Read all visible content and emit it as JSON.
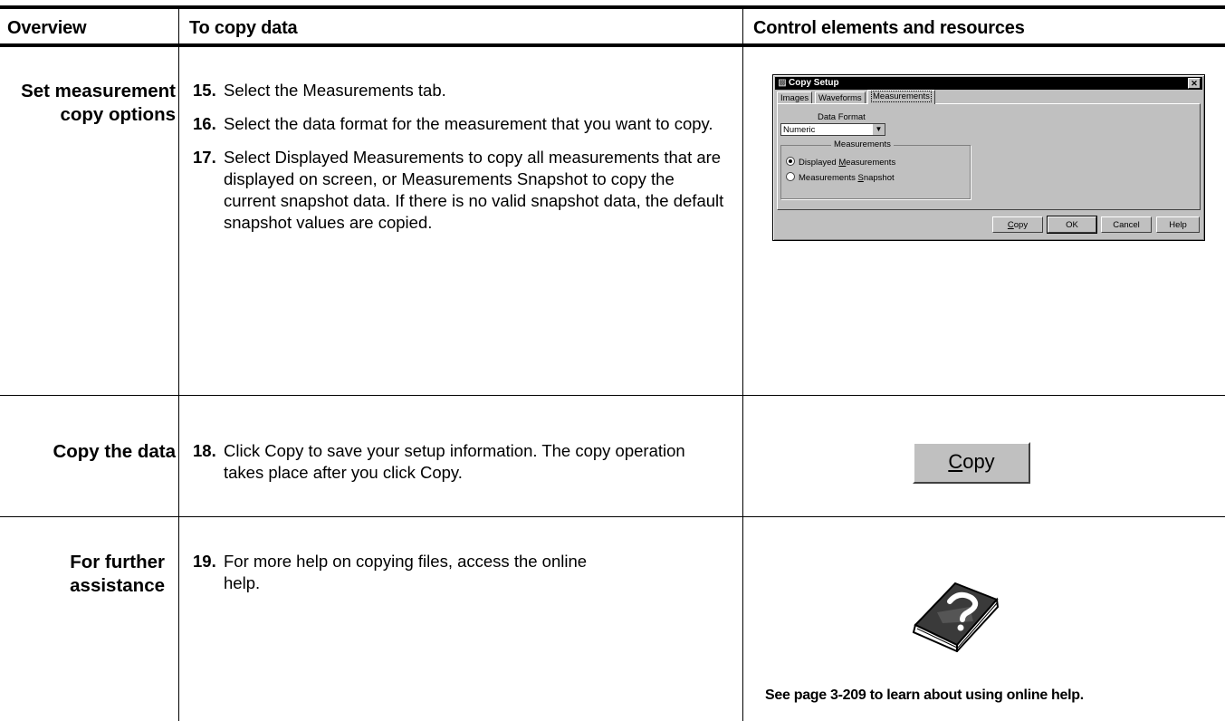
{
  "header": {
    "col1": "Overview",
    "col2": "To copy data",
    "col3": "Control elements and resources"
  },
  "rows": [
    {
      "overview": "Set measurement copy options",
      "steps": [
        {
          "num": "15.",
          "text": "Select the Measurements tab."
        },
        {
          "num": "16.",
          "text": "Select the data format for the measurement that you want to copy."
        },
        {
          "num": "17.",
          "text": "Select Displayed Measurements to copy all measurements that are displayed on screen, or Measurements Snapshot to copy the current snapshot data. If there is no valid snapshot data, the default snapshot values are copied."
        }
      ]
    },
    {
      "overview": "Copy the data",
      "steps": [
        {
          "num": "18.",
          "text": "Click Copy to save your setup information. The copy operation takes place after you click Copy."
        }
      ]
    },
    {
      "overview": "For further assistance",
      "steps": [
        {
          "num": "19.",
          "text": "For more help on copying files, access the online help."
        }
      ]
    }
  ],
  "dialog": {
    "title": "Copy Setup",
    "tabs": [
      "Images",
      "Waveforms",
      "Measurements"
    ],
    "active_tab": "Measurements",
    "data_format_label": "Data Format",
    "data_format_value": "Numeric",
    "group_label": "Measurements",
    "radio_options": [
      {
        "label_pre": "Displayed ",
        "label_ul": "M",
        "label_post": "easurements",
        "selected": true
      },
      {
        "label_pre": "Measurements ",
        "label_ul": "S",
        "label_post": "napshot",
        "selected": false
      }
    ],
    "buttons": {
      "copy_ul": "C",
      "copy_rest": "opy",
      "ok": "OK",
      "cancel": "Cancel",
      "help": "Help"
    }
  },
  "copy_button": {
    "ul": "C",
    "rest": "opy"
  },
  "help_reference": "See page  3-209 to learn about using online help.",
  "icons": {
    "help_book": "help-book-icon"
  }
}
